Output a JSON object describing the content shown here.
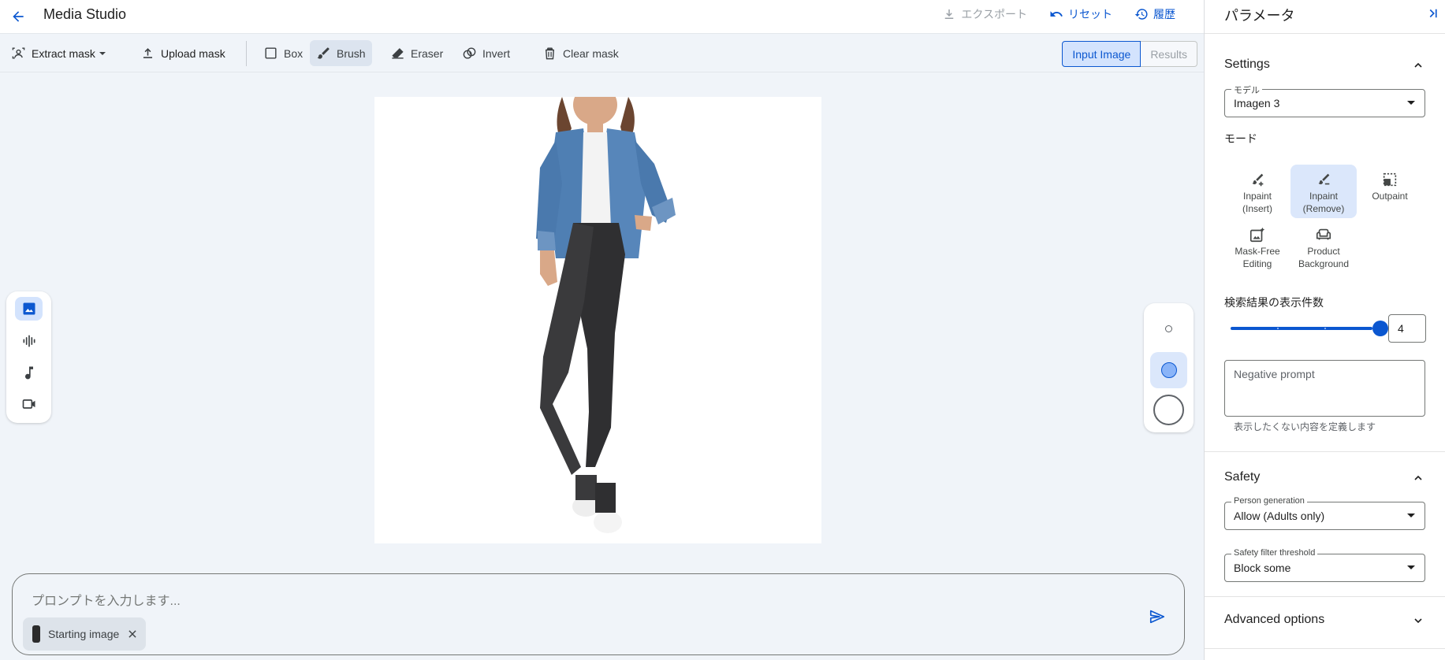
{
  "header": {
    "title": "Media Studio",
    "export_label": "エクスポート",
    "reset_label": "リセット",
    "history_label": "履歴"
  },
  "toolbar": {
    "extract_mask": "Extract mask",
    "upload_mask": "Upload mask",
    "box": "Box",
    "brush": "Brush",
    "eraser": "Eraser",
    "invert": "Invert",
    "clear_mask": "Clear mask",
    "input_image_tab": "Input Image",
    "results_tab": "Results"
  },
  "media_rail": [
    "image-icon",
    "audio-icon",
    "music-icon",
    "video-icon"
  ],
  "brush_sizes": {
    "selected": "medium"
  },
  "prompt": {
    "placeholder": "プロンプトを入力します...",
    "chip_label": "Starting image"
  },
  "panel": {
    "title": "パラメータ",
    "settings": {
      "title": "Settings",
      "model_label": "モデル",
      "model_value": "Imagen 3",
      "mode_label": "モード",
      "modes": [
        {
          "line1": "Inpaint",
          "line2": "(Insert)",
          "icon": "brush-plus-icon"
        },
        {
          "line1": "Inpaint",
          "line2": "(Remove)",
          "icon": "brush-minus-icon",
          "selected": true
        },
        {
          "line1": "Outpaint",
          "line2": "",
          "icon": "outpaint-icon"
        },
        {
          "line1": "Mask-Free",
          "line2": "Editing",
          "icon": "image-sparkle-icon"
        },
        {
          "line1": "Product",
          "line2": "Background",
          "icon": "sofa-icon"
        }
      ],
      "count_label": "検索結果の表示件数",
      "count_value": "4",
      "negative_prompt_placeholder": "Negative prompt",
      "negative_prompt_hint": "表示したくない内容を定義します"
    },
    "safety": {
      "title": "Safety",
      "person_label": "Person generation",
      "person_value": "Allow (Adults only)",
      "filter_label": "Safety filter threshold",
      "filter_value": "Block some"
    },
    "advanced": {
      "title": "Advanced options"
    }
  },
  "colors": {
    "accent": "#0b57d0",
    "canvas_bg": "#f0f4f9",
    "selected_bg": "#d3e3fd"
  }
}
